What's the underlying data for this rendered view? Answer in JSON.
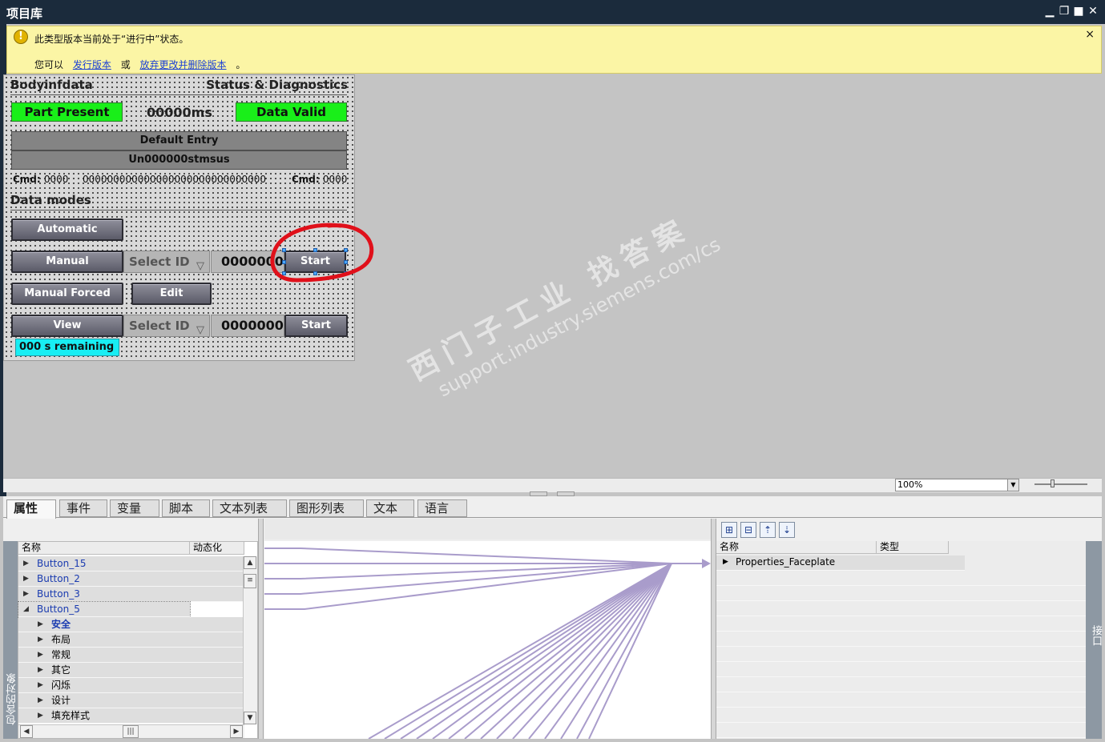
{
  "window": {
    "title": "项目库",
    "controls": [
      "minimize-icon",
      "restore-icon",
      "maximize-icon",
      "close-icon"
    ]
  },
  "infobar": {
    "message": "此类型版本当前处于“进行中”状态。",
    "prefix": "您可以",
    "link1": "发行版本",
    "or": "或",
    "link2": "放弃更改并删除版本",
    "suffix": "。",
    "close": "×"
  },
  "faceplate": {
    "header_left": "Bodyinfdata",
    "header_right": "Status & Diagnostics",
    "part_present": "Part Present",
    "time": "00000ms",
    "data_valid": "Data Valid",
    "default_entry": "Default Entry",
    "status_line": "Un000000stmsus",
    "cmd_left_label": "Cmd:",
    "cmd_left_value": "0000",
    "cmd_middle": "000000000000000000000000000000",
    "cmd_right_label": "Cmd:",
    "cmd_right_value": "0000",
    "data_modes": "Data modes",
    "automatic": "Automatic",
    "manual": "Manual",
    "select_id_1": "Select ID",
    "value_1": "0000000",
    "start_1": "Start",
    "manual_forced": "Manual Forced",
    "edit": "Edit",
    "view": "View",
    "select_id_2": "Select ID",
    "value_2": "0000000",
    "start_2": "Start",
    "remaining": "000 s remaining"
  },
  "watermark": {
    "line1": "西门子工业   找答案",
    "line2": "support.industry.siemens.com/cs"
  },
  "zoom": {
    "value": "100%"
  },
  "tabs": [
    "属性",
    "事件",
    "变量",
    "脚本",
    "文本列表",
    "图形列表",
    "文本",
    "语言"
  ],
  "left_panel": {
    "vertical_label": "包含的对象",
    "col_name": "名称",
    "col_dynamic": "动态化",
    "rows": [
      {
        "label": "Button_15",
        "level": 0,
        "expanded": false,
        "style": "blue"
      },
      {
        "label": "Button_2",
        "level": 0,
        "expanded": false,
        "style": "blue"
      },
      {
        "label": "Button_3",
        "level": 0,
        "expanded": false,
        "style": "blue"
      },
      {
        "label": "Button_5",
        "level": 0,
        "expanded": true,
        "style": "blue"
      },
      {
        "label": "安全",
        "level": 1,
        "expanded": false,
        "style": "blue-bold"
      },
      {
        "label": "布局",
        "level": 1,
        "expanded": false,
        "style": "normal"
      },
      {
        "label": "常规",
        "level": 1,
        "expanded": false,
        "style": "normal"
      },
      {
        "label": "其它",
        "level": 1,
        "expanded": false,
        "style": "normal"
      },
      {
        "label": "闪烁",
        "level": 1,
        "expanded": false,
        "style": "normal"
      },
      {
        "label": "设计",
        "level": 1,
        "expanded": false,
        "style": "normal"
      },
      {
        "label": "填充样式",
        "level": 1,
        "expanded": false,
        "style": "normal"
      }
    ]
  },
  "right_panel": {
    "vertical_label": "接口",
    "col_name": "名称",
    "col_type": "类型",
    "rows": [
      {
        "label": "Properties_Faceplate"
      }
    ]
  },
  "colors": {
    "title_bg": "#1b2b3c",
    "infobar_bg": "#fbf5a5",
    "green": "#19ef19",
    "cyan": "#18eef3",
    "link_line": "#a99ccb",
    "annotation": "#e0101a"
  }
}
